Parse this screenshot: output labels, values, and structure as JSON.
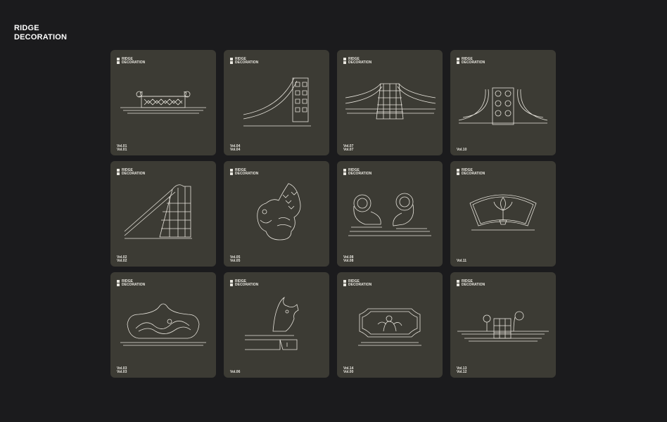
{
  "title": {
    "line1": "RIDGE",
    "line2": "DECORATION"
  },
  "card_label": {
    "line1": "RIDGE",
    "line2": "DECORATION"
  },
  "cards": [
    {
      "vol": [
        "Vol.01",
        "Vol.01"
      ],
      "art": "roof-ridge-lattice-icon"
    },
    {
      "vol": [
        "Vol.04",
        "Vol.04"
      ],
      "art": "curved-ridge-lattice-icon"
    },
    {
      "vol": [
        "Vol.07",
        "Vol.07"
      ],
      "art": "double-ridge-lattice-icon"
    },
    {
      "vol": [
        "Vol.10"
      ],
      "art": "ridge-circle-pattern-icon"
    },
    {
      "vol": [
        "Vol.02",
        "Vol.02"
      ],
      "art": "sloped-ridge-lattice-icon"
    },
    {
      "vol": [
        "Vol.05",
        "Vol.05"
      ],
      "art": "fish-dragon-ornament-icon"
    },
    {
      "vol": [
        "Vol.08",
        "Vol.08"
      ],
      "art": "twin-scroll-ornament-icon"
    },
    {
      "vol": [
        "Vol.11"
      ],
      "art": "fan-panel-lotus-icon"
    },
    {
      "vol": [
        "Vol.03",
        "Vol.03"
      ],
      "art": "dragon-relief-panel-icon"
    },
    {
      "vol": [
        "Vol.06"
      ],
      "art": "bird-head-ridge-end-icon"
    },
    {
      "vol": [
        "Vol.14",
        "Vol.00"
      ],
      "art": "figure-relief-panel-icon"
    },
    {
      "vol": [
        "Vol.13",
        "Vol.12"
      ],
      "art": "ridge-lattice-scroll-icon"
    }
  ],
  "colors": {
    "background": "#1b1b1d",
    "card": "#3c3b34",
    "line": "#e7e4dc"
  }
}
